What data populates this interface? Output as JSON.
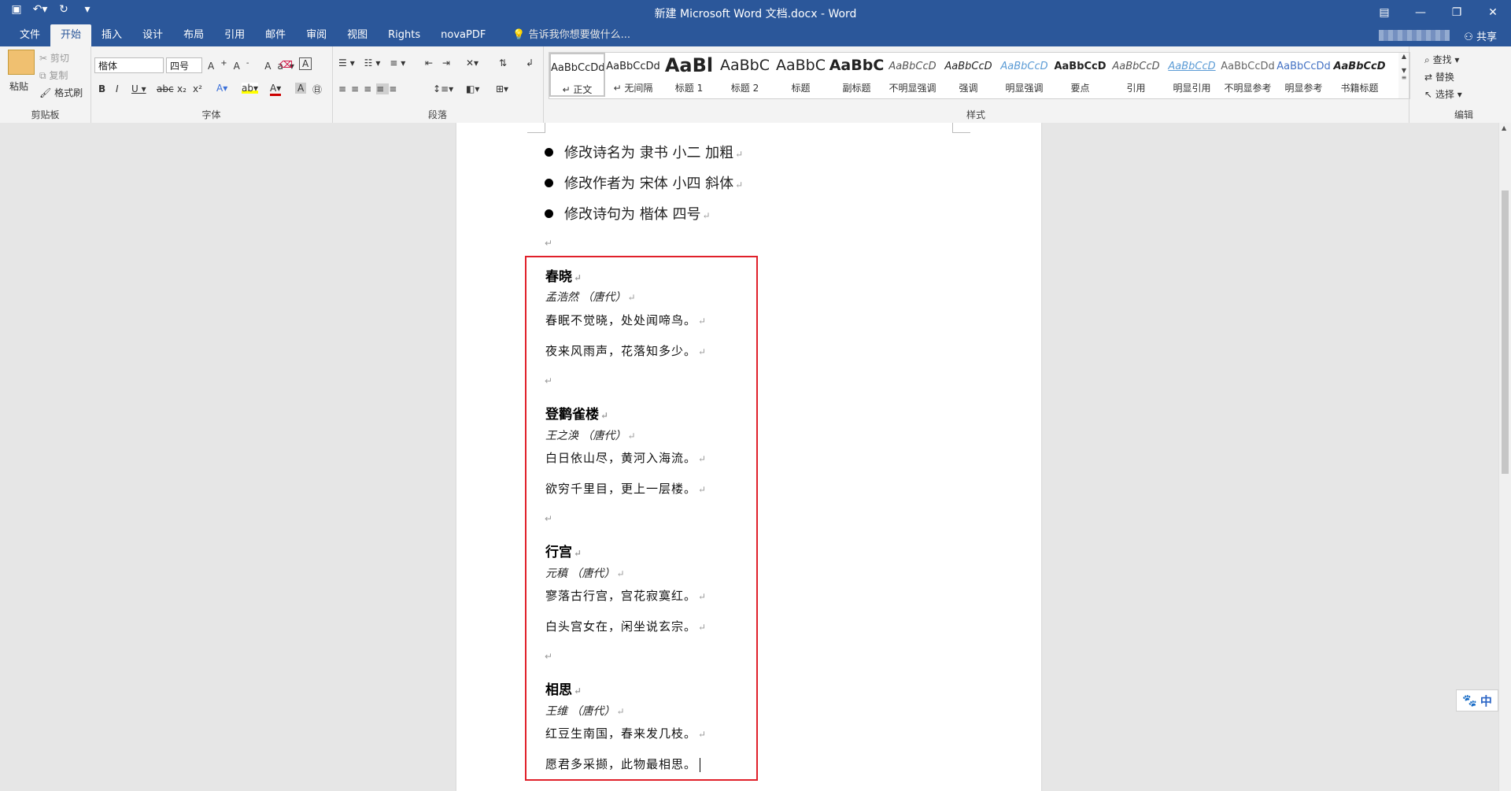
{
  "window": {
    "title": "新建 Microsoft Word 文档.docx - Word",
    "qat_icons": [
      "save-icon",
      "undo-icon",
      "redo-icon",
      "customize-icon"
    ],
    "share": "共享"
  },
  "tabs": [
    {
      "label": "文件",
      "active": false
    },
    {
      "label": "开始",
      "active": true
    },
    {
      "label": "插入",
      "active": false
    },
    {
      "label": "设计",
      "active": false
    },
    {
      "label": "布局",
      "active": false
    },
    {
      "label": "引用",
      "active": false
    },
    {
      "label": "邮件",
      "active": false
    },
    {
      "label": "审阅",
      "active": false
    },
    {
      "label": "视图",
      "active": false
    },
    {
      "label": "Rights",
      "active": false
    },
    {
      "label": "novaPDF",
      "active": false
    }
  ],
  "tellme": "告诉我你想要做什么...",
  "ribbon": {
    "clipboard": {
      "label": "剪贴板",
      "paste": "粘贴",
      "cut": "剪切",
      "copy": "复制",
      "format_painter": "格式刷"
    },
    "font": {
      "label": "字体",
      "font_name": "楷体",
      "font_size": "四号"
    },
    "paragraph": {
      "label": "段落"
    },
    "styles": {
      "label": "样式",
      "items": [
        {
          "sample": "AaBbCcDd",
          "name": "↵ 正文"
        },
        {
          "sample": "AaBbCcDd",
          "name": "↵ 无间隔"
        },
        {
          "sample": "AaBl",
          "name": "标题 1"
        },
        {
          "sample": "AaBbC",
          "name": "标题 2"
        },
        {
          "sample": "AaBbC",
          "name": "标题"
        },
        {
          "sample": "AaBbC",
          "name": "副标题"
        },
        {
          "sample": "AaBbCcD",
          "name": "不明显强调"
        },
        {
          "sample": "AaBbCcD",
          "name": "强调"
        },
        {
          "sample": "AaBbCcD",
          "name": "明显强调"
        },
        {
          "sample": "AaBbCcD",
          "name": "要点"
        },
        {
          "sample": "AaBbCcD",
          "name": "引用"
        },
        {
          "sample": "AaBbCcD",
          "name": "明显引用"
        },
        {
          "sample": "AaBbCcDd",
          "name": "不明显参考"
        },
        {
          "sample": "AaBbCcDd",
          "name": "明显参考"
        },
        {
          "sample": "AaBbCcD",
          "name": "书籍标题"
        }
      ]
    },
    "editing": {
      "label": "编辑",
      "find": "查找",
      "replace": "替换",
      "select": "选择"
    }
  },
  "document": {
    "bullets": [
      "修改诗名为 隶书 小二 加粗",
      "修改作者为 宋体 小四 斜体",
      "修改诗句为 楷体 四号"
    ],
    "poems": [
      {
        "title": "春晓",
        "author": "孟浩然 （唐代）",
        "lines": [
          "春眠不觉晓，处处闻啼鸟。",
          "夜来风雨声，花落知多少。"
        ]
      },
      {
        "title": "登鹳雀楼",
        "author": "王之涣 （唐代）",
        "lines": [
          "白日依山尽，黄河入海流。",
          "欲穷千里目，更上一层楼。"
        ]
      },
      {
        "title": "行宫",
        "author": "元稹 （唐代）",
        "lines": [
          "寥落古行宫，宫花寂寞红。",
          "白头宫女在，闲坐说玄宗。"
        ]
      },
      {
        "title": "相思",
        "author": "王维 （唐代）",
        "lines": [
          "红豆生南国，春来发几枝。",
          "愿君多采撷，此物最相思。"
        ]
      }
    ],
    "para_mark": "↵"
  },
  "ime": {
    "label": "中"
  }
}
